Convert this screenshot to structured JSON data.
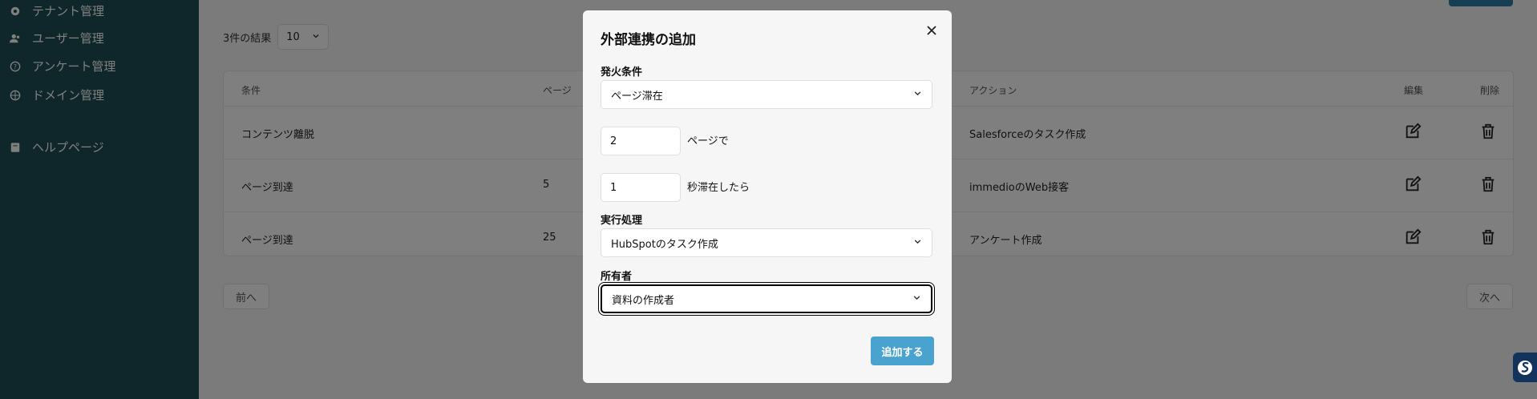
{
  "sidebar": {
    "items": [
      {
        "label": "テナント管理",
        "icon": "gear-icon"
      },
      {
        "label": "ユーザー管理",
        "icon": "users-icon"
      },
      {
        "label": "アンケート管理",
        "icon": "question-icon"
      },
      {
        "label": "ドメイン管理",
        "icon": "globe-icon"
      },
      {
        "label": "ヘルプページ",
        "icon": "book-icon"
      }
    ]
  },
  "main": {
    "results_text": "3件の結果",
    "per_page": "10",
    "table": {
      "headers": [
        "条件",
        "ページ",
        "アクション",
        "編集",
        "削除"
      ],
      "rows": [
        {
          "condition": "コンテンツ離脱",
          "page": "",
          "action": "Salesforceのタスク作成"
        },
        {
          "condition": "ページ到達",
          "page": "5",
          "action": "immedioのWeb接客"
        },
        {
          "condition": "ページ到達",
          "page": "25",
          "action": "アンケート作成"
        }
      ]
    },
    "pager": {
      "prev": "前へ",
      "next": "次へ"
    }
  },
  "modal": {
    "title": "外部連携の追加",
    "trigger_label": "発火条件",
    "trigger_value": "ページ滞在",
    "page_value": "2",
    "page_suffix": "ページで",
    "seconds_value": "1",
    "seconds_suffix": "秒滞在したら",
    "action_label": "実行処理",
    "action_value": "HubSpotのタスク作成",
    "owner_label": "所有者",
    "owner_value": "資料の作成者",
    "submit_label": "追加する"
  },
  "colors": {
    "sidebar_bg": "#1f4d57",
    "submit_bg": "#4aa3cf",
    "overlay": "rgba(0,0,0,0.5)"
  }
}
